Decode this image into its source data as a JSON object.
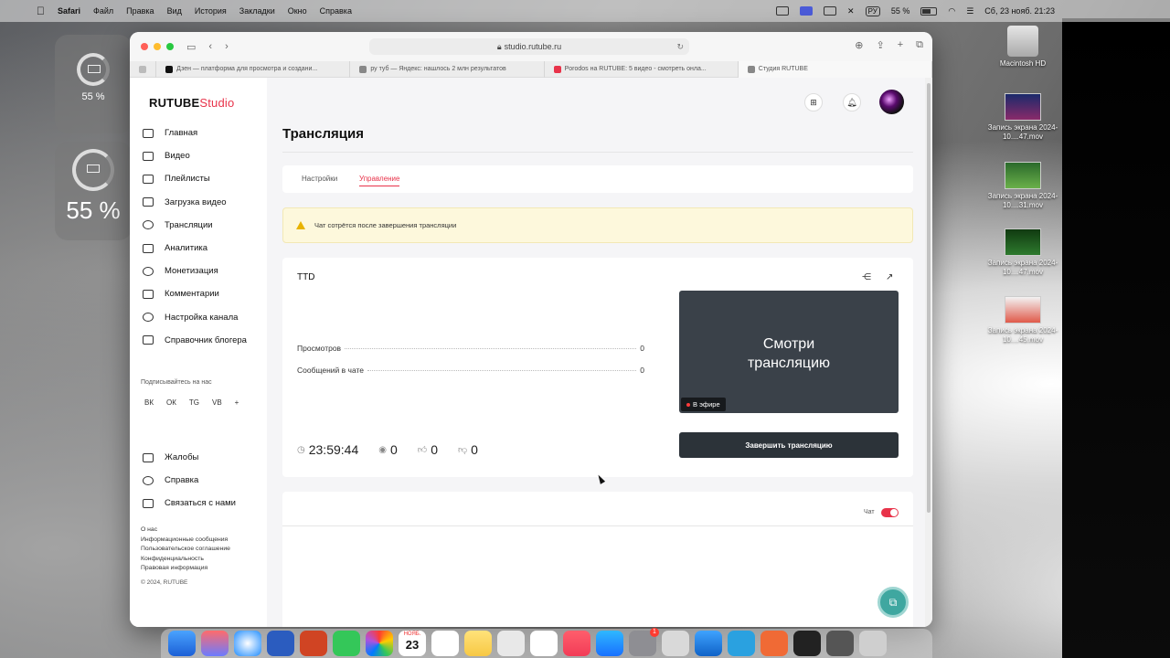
{
  "menubar": {
    "app": "Safari",
    "items": [
      "Файл",
      "Правка",
      "Вид",
      "История",
      "Закладки",
      "Окно",
      "Справка"
    ],
    "lang": "РУ",
    "battery": "55 %",
    "datetime": "Сб, 23 нояб.  21:23"
  },
  "widgets": {
    "battery_small": "55 %",
    "battery_large": "55 %"
  },
  "desktop": {
    "items": [
      {
        "label": "Macintosh HD"
      },
      {
        "label": "Запись экрана 2024-10....47.mov"
      },
      {
        "label": "Запись экрана 2024-10....31.mov"
      },
      {
        "label": "Запись экрана 2024-10....47.mov"
      },
      {
        "label": "Запись экрана 2024-10....45.mov"
      }
    ]
  },
  "browser": {
    "url": "studio.rutube.ru",
    "tabs": [
      {
        "title": "Дзен — платформа для просмотра и создани...",
        "color": "#111111"
      },
      {
        "title": "ру туб — Яндекс: нашлось 2 млн результатов",
        "color": "#888888"
      },
      {
        "title": "Porodos на RUTUBE: 5 видео - смотреть онла...",
        "color": "#e8334a"
      },
      {
        "title": "Студия RUTUBE",
        "color": "#888888"
      }
    ]
  },
  "brand": {
    "logo_main": "RUTUBE",
    "logo_studio": "Studio",
    "accent": "#e8334a"
  },
  "sidebar": {
    "items": [
      {
        "label": "Главная",
        "icon": "home-icon"
      },
      {
        "label": "Видео",
        "icon": "video-icon"
      },
      {
        "label": "Плейлисты",
        "icon": "playlist-icon"
      },
      {
        "label": "Загрузка видео",
        "icon": "upload-icon"
      },
      {
        "label": "Трансляции",
        "icon": "broadcast-icon"
      },
      {
        "label": "Аналитика",
        "icon": "analytics-icon"
      },
      {
        "label": "Монетизация",
        "icon": "monetization-icon"
      },
      {
        "label": "Комментарии",
        "icon": "comments-icon"
      },
      {
        "label": "Настройка канала",
        "icon": "gear-icon"
      },
      {
        "label": "Справочник блогера",
        "icon": "book-icon"
      }
    ],
    "subscribe_title": "Подписывайтесь на нас",
    "socials": [
      "ВК",
      "ОК",
      "TG",
      "VB",
      "+"
    ],
    "secondary": [
      {
        "label": "Жалобы",
        "icon": "flag-icon"
      },
      {
        "label": "Справка",
        "icon": "help-icon"
      },
      {
        "label": "Связаться с нами",
        "icon": "mail-icon"
      }
    ],
    "footer_links": [
      "О нас",
      "Информационные сообщения",
      "Пользовательское соглашение",
      "Конфиденциальность",
      "Правовая информация"
    ],
    "copyright": "© 2024, RUTUBE"
  },
  "page": {
    "title": "Трансляция",
    "tabs": [
      {
        "label": "Настройки",
        "active": false
      },
      {
        "label": "Управление",
        "active": true
      }
    ],
    "warning": "Чат сотрётся после завершения трансляции"
  },
  "stream": {
    "title": "TTD",
    "stats": [
      {
        "label": "Просмотров",
        "value": "0"
      },
      {
        "label": "Сообщений в чате",
        "value": "0"
      }
    ],
    "timer": "23:59:44",
    "viewers": "0",
    "likes": "0",
    "dislikes": "0",
    "preview_line1": "Смотри",
    "preview_line2": "трансляцию",
    "live_label": "В эфире",
    "end_button": "Завершить трансляцию"
  },
  "chat": {
    "toggle_label": "Чат",
    "enabled": true
  }
}
